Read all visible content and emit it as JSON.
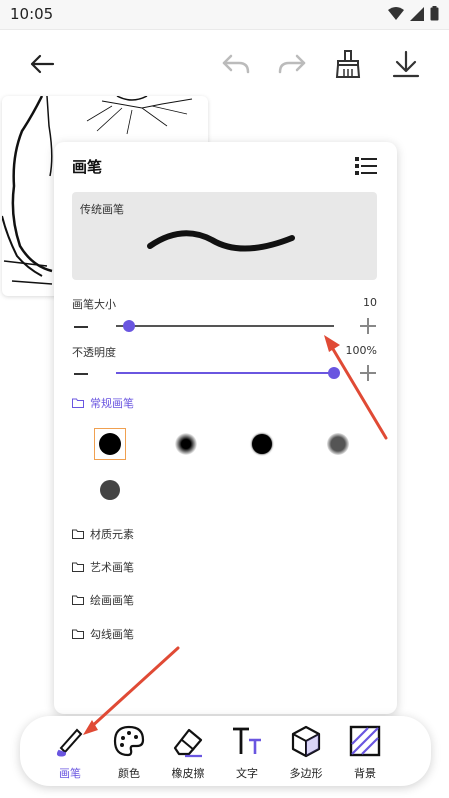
{
  "status": {
    "time": "10:05"
  },
  "colors": {
    "accent": "#6a56e0",
    "arrow": "#e04a35",
    "selection": "#f0a050"
  },
  "toolbar": {
    "icons": [
      "back-arrow-icon",
      "undo-icon",
      "redo-icon",
      "clear-broom-icon",
      "download-icon"
    ]
  },
  "panel": {
    "title": "画笔",
    "preview_label": "传统画笔",
    "size": {
      "label": "画笔大小",
      "value": "10",
      "level": 0.06
    },
    "opacity": {
      "label": "不透明度",
      "value": "100%",
      "level": 1.0
    },
    "folders": [
      {
        "label": "常规画笔",
        "active": true
      },
      {
        "label": "材质元素",
        "active": false
      },
      {
        "label": "艺术画笔",
        "active": false
      },
      {
        "label": "绘画画笔",
        "active": false
      },
      {
        "label": "勾线画笔",
        "active": false
      }
    ]
  },
  "tools": [
    {
      "label": "画笔",
      "icon": "brush-icon",
      "active": true
    },
    {
      "label": "颜色",
      "icon": "palette-icon",
      "active": false
    },
    {
      "label": "橡皮擦",
      "icon": "eraser-icon",
      "active": false
    },
    {
      "label": "文字",
      "icon": "text-icon",
      "active": false
    },
    {
      "label": "多边形",
      "icon": "polygon-cube-icon",
      "active": false
    },
    {
      "label": "背景",
      "icon": "background-hatch-icon",
      "active": false
    }
  ]
}
